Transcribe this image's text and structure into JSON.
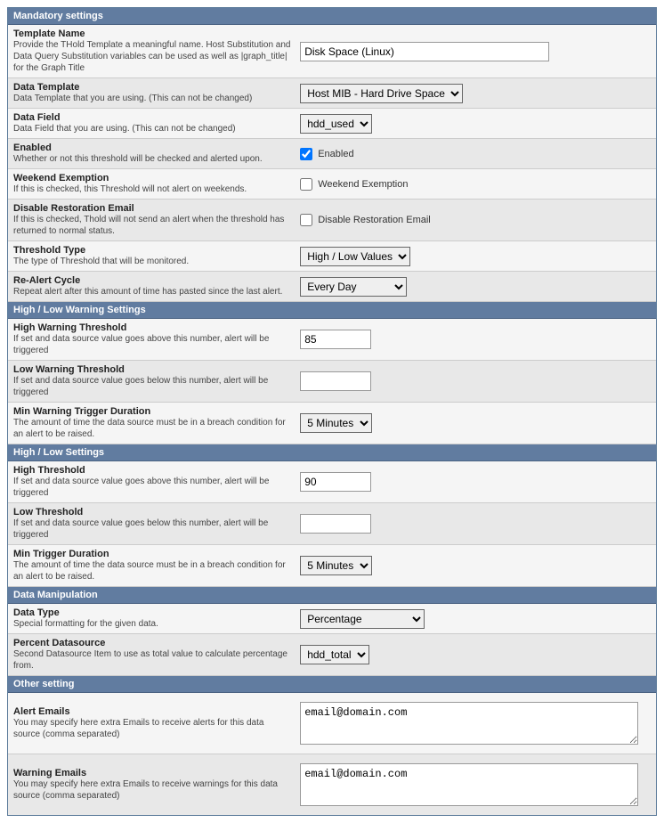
{
  "sections": {
    "mandatory": {
      "header": "Mandatory settings",
      "template_name": {
        "title": "Template Name",
        "desc": "Provide the THold Template a meaningful name. Host Substitution and Data Query Substitution variables can be used as well as |graph_title| for the Graph Title",
        "value": "Disk Space (Linux)"
      },
      "data_template": {
        "title": "Data Template",
        "desc": "Data Template that you are using. (This can not be changed)",
        "value": "Host MIB - Hard Drive Space"
      },
      "data_field": {
        "title": "Data Field",
        "desc": "Data Field that you are using. (This can not be changed)",
        "value": "hdd_used"
      },
      "enabled": {
        "title": "Enabled",
        "desc": "Whether or not this threshold will be checked and alerted upon.",
        "label": "Enabled"
      },
      "weekend": {
        "title": "Weekend Exemption",
        "desc": "If this is checked, this Threshold will not alert on weekends.",
        "label": "Weekend Exemption"
      },
      "disable_restore": {
        "title": "Disable Restoration Email",
        "desc": "If this is checked, Thold will not send an alert when the threshold has returned to normal status.",
        "label": "Disable Restoration Email"
      },
      "threshold_type": {
        "title": "Threshold Type",
        "desc": "The type of Threshold that will be monitored.",
        "value": "High / Low Values"
      },
      "realert": {
        "title": "Re-Alert Cycle",
        "desc": "Repeat alert after this amount of time has pasted since the last alert.",
        "value": "Every Day"
      }
    },
    "warning": {
      "header": "High / Low Warning Settings",
      "high": {
        "title": "High Warning Threshold",
        "desc": "If set and data source value goes above this number, alert will be triggered",
        "value": "85"
      },
      "low": {
        "title": "Low Warning Threshold",
        "desc": "If set and data source value goes below this number, alert will be triggered",
        "value": ""
      },
      "duration": {
        "title": "Min Warning Trigger Duration",
        "desc": "The amount of time the data source must be in a breach condition for an alert to be raised.",
        "value": "5 Minutes"
      }
    },
    "highlow": {
      "header": "High / Low Settings",
      "high": {
        "title": "High Threshold",
        "desc": "If set and data source value goes above this number, alert will be triggered",
        "value": "90"
      },
      "low": {
        "title": "Low Threshold",
        "desc": "If set and data source value goes below this number, alert will be triggered",
        "value": ""
      },
      "duration": {
        "title": "Min Trigger Duration",
        "desc": "The amount of time the data source must be in a breach condition for an alert to be raised.",
        "value": "5 Minutes"
      }
    },
    "manipulation": {
      "header": "Data Manipulation",
      "data_type": {
        "title": "Data Type",
        "desc": "Special formatting for the given data.",
        "value": "Percentage"
      },
      "percent_ds": {
        "title": "Percent Datasource",
        "desc": "Second Datasource Item to use as total value to calculate percentage from.",
        "value": "hdd_total"
      }
    },
    "other": {
      "header": "Other setting",
      "alert_emails": {
        "title": "Alert Emails",
        "desc": "You may specify here extra Emails to receive alerts for this data source (comma separated)",
        "value": "email@domain.com"
      },
      "warning_emails": {
        "title": "Warning Emails",
        "desc": "You may specify here extra Emails to receive warnings for this data source (comma separated)",
        "value": "email@domain.com"
      }
    }
  }
}
